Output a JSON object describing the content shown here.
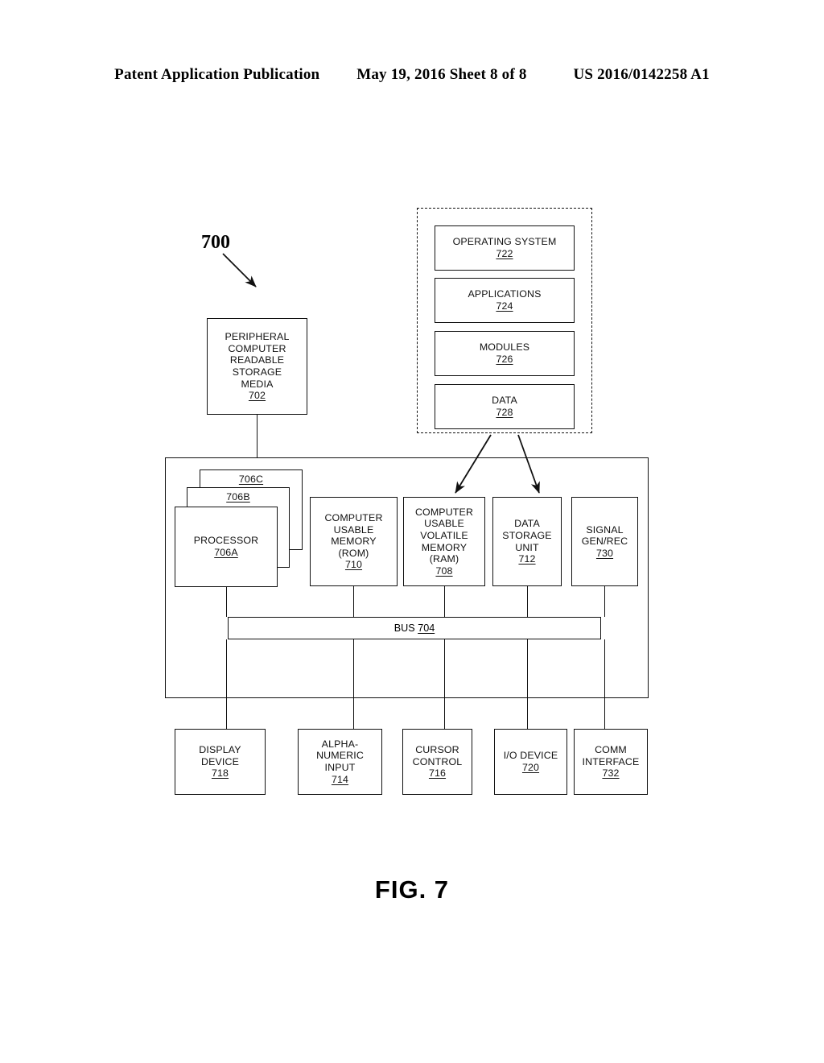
{
  "header": {
    "publication": "Patent Application Publication",
    "date_sheet": "May 19, 2016  Sheet 8 of 8",
    "patent_number": "US 2016/0142258 A1"
  },
  "figure": {
    "caption": "FIG. 7",
    "reference_numeral": "700",
    "bus_label": "BUS",
    "bus_number": "704"
  },
  "peripheral_storage": {
    "line1": "PERIPHERAL",
    "line2": "COMPUTER",
    "line3": "READABLE",
    "line4": "STORAGE",
    "line5": "MEDIA",
    "number": "702"
  },
  "software_stack": {
    "items": [
      {
        "label": "OPERATING SYSTEM",
        "number": "722"
      },
      {
        "label": "APPLICATIONS",
        "number": "724"
      },
      {
        "label": "MODULES",
        "number": "726"
      },
      {
        "label": "DATA",
        "number": "728"
      }
    ]
  },
  "processors": {
    "stack_c": "706C",
    "stack_b": "706B",
    "label": "PROCESSOR",
    "number": "706A"
  },
  "memory": {
    "rom": {
      "line1": "COMPUTER",
      "line2": "USABLE",
      "line3": "MEMORY",
      "line4": "(ROM)",
      "number": "710"
    },
    "ram": {
      "line1": "COMPUTER",
      "line2": "USABLE",
      "line3": "VOLATILE",
      "line4": "MEMORY",
      "line5": "(RAM)",
      "number": "708"
    }
  },
  "data_storage": {
    "line1": "DATA",
    "line2": "STORAGE",
    "line3": "UNIT",
    "number": "712"
  },
  "signal_gen": {
    "line1": "SIGNAL",
    "line2": "GEN/REC",
    "number": "730"
  },
  "peripherals": {
    "display": {
      "line1": "DISPLAY",
      "line2": "DEVICE",
      "number": "718"
    },
    "alphanumeric": {
      "line1": "ALPHA-",
      "line2": "NUMERIC",
      "line3": "INPUT",
      "number": "714"
    },
    "cursor": {
      "line1": "CURSOR",
      "line2": "CONTROL",
      "number": "716"
    },
    "io_device": {
      "line1": "I/O DEVICE",
      "number": "720"
    },
    "comm": {
      "line1": "COMM",
      "line2": "INTERFACE",
      "number": "732"
    }
  },
  "colors": {
    "ink": "#111111",
    "paper": "#ffffff"
  }
}
